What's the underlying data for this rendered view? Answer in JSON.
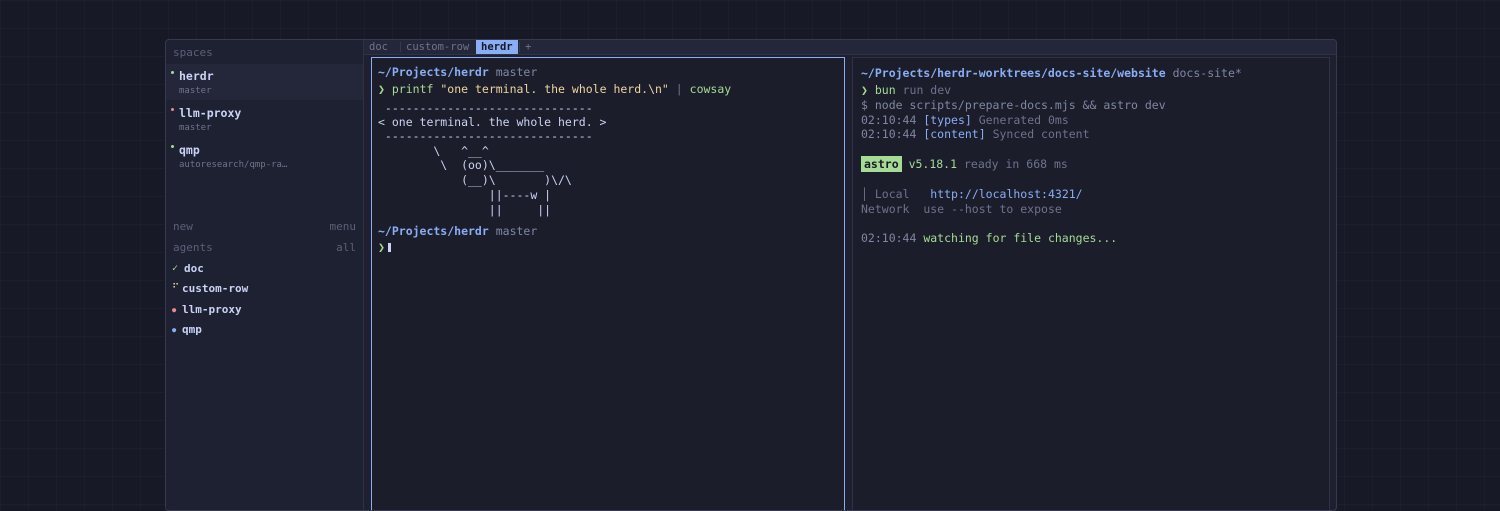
{
  "sidebar": {
    "spaces_header": "spaces",
    "spaces": [
      {
        "name": "herdr",
        "branch": "master",
        "dot_color": "#a6da95"
      },
      {
        "name": "llm-proxy",
        "branch": "master",
        "dot_color": "#ed8796"
      },
      {
        "name": "qmp",
        "branch": "autoresearch/qmp-ra…",
        "dot_color": "#a6da95"
      }
    ],
    "new_label": "new",
    "menu_label": "menu",
    "agents_header": "agents",
    "agents_filter": "all",
    "agents": [
      {
        "label": "doc",
        "mark": "✓",
        "mark_color": "#a6da95"
      },
      {
        "label": "custom-row",
        "mark": "⠋",
        "mark_color": "#eed49f"
      },
      {
        "label": "llm-proxy",
        "mark": "●",
        "mark_color": "#ed8796"
      },
      {
        "label": "qmp",
        "mark": "●",
        "mark_color": "#8aadf4"
      }
    ]
  },
  "tabs": [
    {
      "label": "doc"
    },
    {
      "label": "custom-row"
    },
    {
      "label": "herdr"
    }
  ],
  "new_tab_label": "+",
  "left_pane": {
    "prompt1_path": "~/Projects/herdr",
    "prompt1_branch": "master",
    "prompt_symbol": "❯",
    "cmd_name": "printf",
    "cmd_arg": "\"one terminal. the whole herd.\\n\"",
    "cmd_pipe": "|",
    "cmd_pipe_to": "cowsay",
    "cowsay": [
      " ------------------------------",
      "< one terminal. the whole herd. >",
      " ------------------------------",
      "        \\   ^__^",
      "         \\  (oo)\\_______",
      "            (__)\\       )\\/\\",
      "                ||----w |",
      "                ||     ||"
    ],
    "prompt2_path": "~/Projects/herdr",
    "prompt2_branch": "master"
  },
  "right_pane": {
    "path": "~/Projects/herdr-worktrees/docs-site/website",
    "branch": "docs-site*",
    "prompt_symbol": "❯",
    "cmd_name": "bun",
    "cmd_args": "run dev",
    "dollar_line": "$ node scripts/prepare-docs.mjs && astro dev",
    "log1_time": "02:10:44",
    "log1_tag": "[types]",
    "log1_msg": "Generated 0ms",
    "log2_time": "02:10:44",
    "log2_tag": "[content]",
    "log2_msg": "Synced content",
    "astro_badge": "astro",
    "astro_version": "v5.18.1",
    "astro_ready": "ready in 668 ms",
    "local_bar": "│",
    "local_label": "Local",
    "local_url": "http://localhost:4321/",
    "network_label": "Network",
    "network_value": "use --host to expose",
    "watch_time": "02:10:44",
    "watch_msg": "watching for file changes..."
  }
}
